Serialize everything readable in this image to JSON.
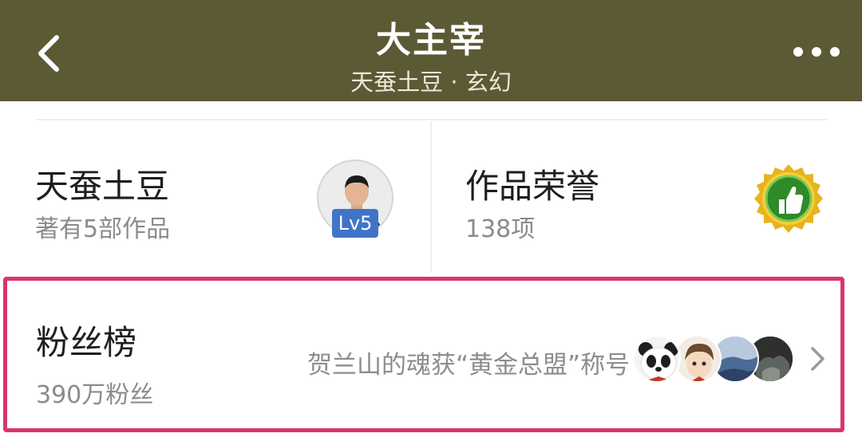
{
  "header": {
    "title": "大主宰",
    "subtitle": "天蚕土豆 · 玄幻",
    "background": "#5b5a35",
    "back_icon": "chevron-left-icon",
    "more_icon": "more-horizontal-icon"
  },
  "author_card": {
    "name": "天蚕土豆",
    "works": "著有5部作品",
    "level": "Lv5"
  },
  "honor_card": {
    "title": "作品荣誉",
    "count": "138项",
    "icon": "thumbs-up-medal-icon"
  },
  "fan_ranking": {
    "title": "粉丝榜",
    "fans": "390万粉丝",
    "news": "贺兰山的魂获“黄金总盟”称号",
    "highlight_color": "#d9366d",
    "avatars": [
      "panda-avatar",
      "anime-boy-avatar",
      "blue-landscape-avatar",
      "dark-scene-avatar"
    ],
    "chevron_icon": "chevron-right-icon"
  }
}
